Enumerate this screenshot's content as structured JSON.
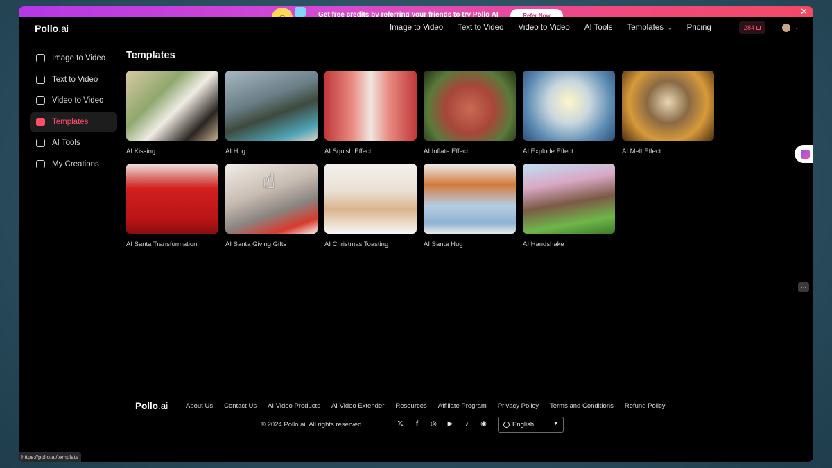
{
  "promo": {
    "text": "Get free credits by referring your friends to try Pollo AI",
    "button": "Refer Now",
    "close": "✕"
  },
  "header": {
    "logo_brand": "Pollo",
    "logo_suffix": ".ai",
    "nav": [
      {
        "label": "Image to Video"
      },
      {
        "label": "Text to Video"
      },
      {
        "label": "Video to Video"
      },
      {
        "label": "AI Tools"
      },
      {
        "label": "Templates"
      },
      {
        "label": "Pricing"
      }
    ],
    "credits": "284"
  },
  "sidebar": {
    "items": [
      {
        "label": "Image to Video",
        "icon": "image-icon"
      },
      {
        "label": "Text to Video",
        "icon": "text-icon"
      },
      {
        "label": "Video to Video",
        "icon": "video-icon"
      },
      {
        "label": "Templates",
        "icon": "templates-icon",
        "active": true
      },
      {
        "label": "AI Tools",
        "icon": "ai-tools-icon"
      },
      {
        "label": "My Creations",
        "icon": "folder-icon"
      }
    ]
  },
  "main": {
    "title": "Templates",
    "templates": [
      {
        "label": "AI Kissing"
      },
      {
        "label": "AI Hug"
      },
      {
        "label": "AI Squish Effect"
      },
      {
        "label": "AI Inflate Effect"
      },
      {
        "label": "AI Explode Effect"
      },
      {
        "label": "AI Melt Effect"
      },
      {
        "label": "AI Santa Transformation"
      },
      {
        "label": "AI Santa Giving Gifts"
      },
      {
        "label": "AI Christmas Toasting"
      },
      {
        "label": "AI Santa Hug"
      },
      {
        "label": "AI Handshake"
      }
    ]
  },
  "footer": {
    "logo_brand": "Pollo",
    "logo_suffix": ".ai",
    "links": [
      {
        "label": "About Us"
      },
      {
        "label": "Contact Us"
      },
      {
        "label": "AI Video Products"
      },
      {
        "label": "AI Video Extender"
      },
      {
        "label": "Resources"
      },
      {
        "label": "Affiliate Program"
      },
      {
        "label": "Privacy Policy"
      },
      {
        "label": "Terms and Conditions"
      },
      {
        "label": "Refund Policy"
      }
    ],
    "copyright": "© 2024 Pollo.ai. All rights reserved.",
    "language": "English",
    "socials": [
      "x-icon",
      "facebook-icon",
      "instagram-icon",
      "youtube-icon",
      "tiktok-icon",
      "discord-icon"
    ]
  },
  "status_bar": {
    "url": "https://pollo.ai/template"
  },
  "colors": {
    "accent": "#ff4d6d",
    "background": "#000000"
  }
}
